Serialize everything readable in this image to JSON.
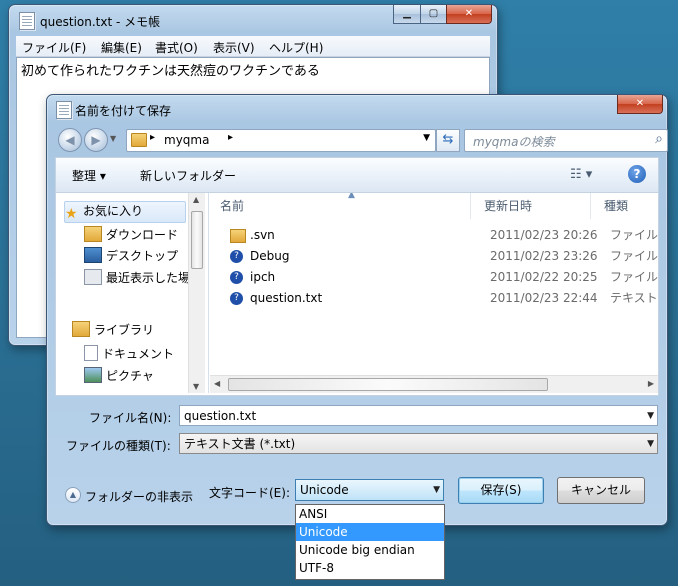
{
  "desktop": {
    "background": "#2a6f94"
  },
  "notepad": {
    "title": "question.txt - メモ帳",
    "menu": [
      "ファイル(F)",
      "編集(E)",
      "書式(O)",
      "表示(V)",
      "ヘルプ(H)"
    ],
    "content": "初めて作られたワクチンは天然痘のワクチンである"
  },
  "dialog": {
    "title": "名前を付けて保存",
    "address": {
      "path_label": "myqma"
    },
    "search": {
      "placeholder": "myqmaの検索"
    },
    "toolbar": {
      "organize": "整理 ▾",
      "new_folder": "新しいフォルダー"
    },
    "nav": {
      "favorites": "お気に入り",
      "items": [
        "ダウンロード",
        "デスクトップ",
        "最近表示した場"
      ],
      "libraries": "ライブラリ",
      "library_items": [
        "ドキュメント",
        "ピクチャ"
      ]
    },
    "columns": {
      "name": "名前",
      "date": "更新日時",
      "type": "種類"
    },
    "files": [
      {
        "name": ".svn",
        "date": "2011/02/23 20:26",
        "type": "ファイル フ"
      },
      {
        "name": "Debug",
        "date": "2011/02/23 23:26",
        "type": "ファイル フ"
      },
      {
        "name": "ipch",
        "date": "2011/02/22 20:25",
        "type": "ファイル フ"
      },
      {
        "name": "question.txt",
        "date": "2011/02/23 22:44",
        "type": "テキスト ト"
      }
    ],
    "filename": {
      "label": "ファイル名(N):",
      "value": "question.txt"
    },
    "filetype": {
      "label": "ファイルの種類(T):",
      "value": "テキスト文書 (*.txt)"
    },
    "hide_folders": "フォルダーの非表示",
    "encoding": {
      "label": "文字コード(E):",
      "value": "Unicode",
      "options": [
        "ANSI",
        "Unicode",
        "Unicode big endian",
        "UTF-8"
      ],
      "selected": "Unicode"
    },
    "buttons": {
      "save": "保存(S)",
      "cancel": "キャンセル"
    }
  }
}
